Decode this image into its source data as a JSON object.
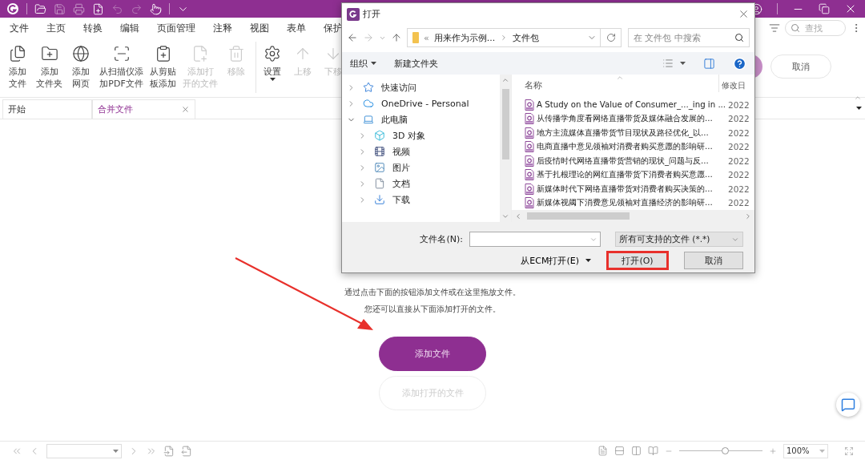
{
  "menu": [
    "文件",
    "主页",
    "转换",
    "编辑",
    "页面管理",
    "注释",
    "视图",
    "表单",
    "保护"
  ],
  "search": {
    "placeholder": "查找"
  },
  "ribbon_groups": [
    [
      {
        "lines": [
          "添加",
          "文件"
        ],
        "disabled": false,
        "kind": "button"
      },
      {
        "lines": [
          "添加",
          "文件夹"
        ],
        "disabled": false,
        "kind": "button"
      },
      {
        "lines": [
          "添加",
          "网页"
        ],
        "disabled": false,
        "kind": "button"
      },
      {
        "lines": [
          "从扫描仪添",
          "加PDF文件"
        ],
        "disabled": false,
        "kind": "button"
      },
      {
        "lines": [
          "从剪贴",
          "板添加"
        ],
        "disabled": false,
        "kind": "button"
      },
      {
        "lines": [
          "添加打",
          "开的文件"
        ],
        "disabled": true,
        "kind": "button"
      },
      {
        "lines": [
          "移除"
        ],
        "disabled": true,
        "kind": "button"
      }
    ],
    [
      {
        "lines": [
          "设置"
        ],
        "disabled": false,
        "kind": "dropdown"
      },
      {
        "lines": [
          "上移"
        ],
        "disabled": true,
        "kind": "button"
      },
      {
        "lines": [
          "下移"
        ],
        "disabled": true,
        "kind": "button"
      }
    ]
  ],
  "cancel_button": "取消",
  "tabs": [
    {
      "label": "开始",
      "selected": false,
      "closable": false
    },
    {
      "label": "合并文件",
      "selected": true,
      "closable": true
    }
  ],
  "content": {
    "hint_lines": [
      "通过点击下面的按钮添加文件或在这里拖放文件。",
      "您还可以直接从下面添加打开的文件。"
    ],
    "add_button": {
      "label": "添加文件",
      "disabled": false
    },
    "add_open_button": {
      "label": "添加打开的文件",
      "disabled": true
    }
  },
  "status_bar": {
    "zoom": "100%",
    "level": 0.55
  },
  "dialog": {
    "title": "打开",
    "breadcrumb_prefix": "«",
    "breadcrumb": [
      "用来作为示例...",
      "文件包"
    ],
    "search_placeholder": "在 文件包 中搜索",
    "toolbar": [
      {
        "label": "组织",
        "kind": "dropdown"
      },
      {
        "label": "新建文件夹",
        "kind": "button"
      }
    ],
    "nav": [
      {
        "label": "快速访问",
        "expanded": false
      },
      {
        "label": "OneDrive - Personal",
        "expanded": false
      },
      {
        "label": "此电脑",
        "expanded": true,
        "children": [
          {
            "label": "3D 对象",
            "expanded": false
          },
          {
            "label": "视频",
            "expanded": false
          },
          {
            "label": "图片",
            "expanded": false
          },
          {
            "label": "文档",
            "expanded": false
          },
          {
            "label": "下载",
            "expanded": false
          }
        ]
      }
    ],
    "columns": [
      "名称",
      "修改日"
    ],
    "files": [
      {
        "name": "A Study on the Value of Consumer_..._ing in ...",
        "date": "2022"
      },
      {
        "name": "从传播学角度看网络直播带货及媒体融合发展的...",
        "date": "2022"
      },
      {
        "name": "地方主流媒体直播带货节目现状及路径优化_以...",
        "date": "2022"
      },
      {
        "name": "电商直播中意见领袖对消费者购买意愿的影响研...",
        "date": "2022"
      },
      {
        "name": "后疫情时代网络直播带货营销的现状_问题与反...",
        "date": "2022"
      },
      {
        "name": "基于扎根理论的网红直播带货下消费者购买意愿...",
        "date": "2022"
      },
      {
        "name": "新媒体时代下网络直播带货对消费者购买决策的...",
        "date": "2022"
      },
      {
        "name": "新媒体视阈下消费意见领袖对直播经济的影响研...",
        "date": "2022"
      }
    ],
    "file_name_label": "文件名(N):",
    "file_type": "所有可支持的文件 (*.*)",
    "ecm_button": "从ECM打开(E)",
    "open_button": {
      "label": "打开(O)",
      "highlighted": true
    },
    "cancel_button": "取消"
  }
}
